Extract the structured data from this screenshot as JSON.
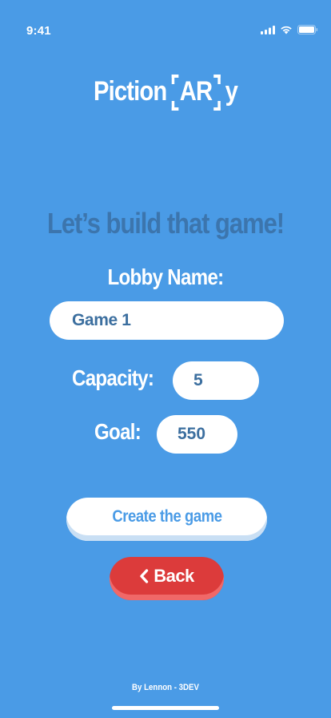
{
  "status_bar": {
    "time": "9:41",
    "icons": [
      "cellular-signal-icon",
      "wifi-icon",
      "battery-icon"
    ]
  },
  "logo": {
    "prefix": "Piction",
    "bracketed": "AR",
    "suffix": "y"
  },
  "heading": "Let’s build that game!",
  "form": {
    "lobby_label": "Lobby Name:",
    "lobby_value": "Game 1",
    "capacity_label": "Capacity:",
    "capacity_value": "5",
    "goal_label": "Goal:",
    "goal_value": "550"
  },
  "buttons": {
    "create_label": "Create the game",
    "back_label": "Back",
    "back_icon": "chevron-left-icon"
  },
  "footer": "By Lennon - 3DEV",
  "colors": {
    "background": "#4a9be6",
    "heading": "#3c75ad",
    "input_text": "#3c6f9f",
    "back_button": "#dc3b3b"
  }
}
